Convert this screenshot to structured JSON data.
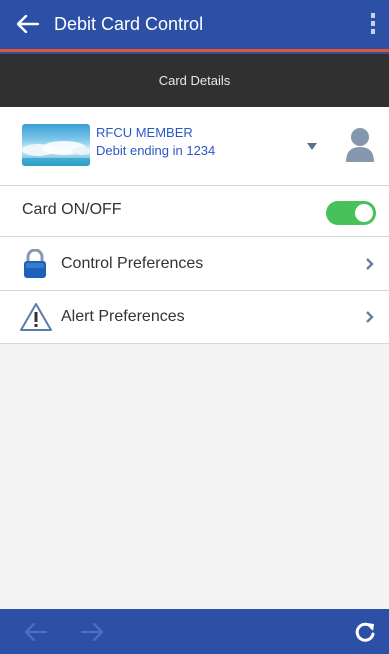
{
  "appbar": {
    "title": "Debit Card Control"
  },
  "subheader": {
    "title": "Card Details"
  },
  "card": {
    "name": "RFCU MEMBER",
    "subtitle": "Debit ending in 1234"
  },
  "rows": {
    "card_toggle": {
      "label": "Card ON/OFF",
      "state": "on"
    },
    "control": {
      "label": "Control Preferences"
    },
    "alert": {
      "label": "Alert Preferences"
    }
  },
  "icons": {
    "back": "back-arrow-icon",
    "menu": "overflow-menu-icon",
    "dropdown": "caret-down-icon",
    "user": "user-icon",
    "lock": "lock-icon",
    "alert": "warning-icon",
    "chevron": "chevron-right-icon",
    "nav_back": "arrow-left-icon",
    "nav_forward": "arrow-right-icon",
    "refresh": "refresh-icon"
  },
  "colors": {
    "primary": "#2c50a6",
    "accent_stripe": "#e4572e",
    "subheader": "#303030",
    "link_blue": "#2b58c6",
    "toggle_on": "#47c25a"
  }
}
